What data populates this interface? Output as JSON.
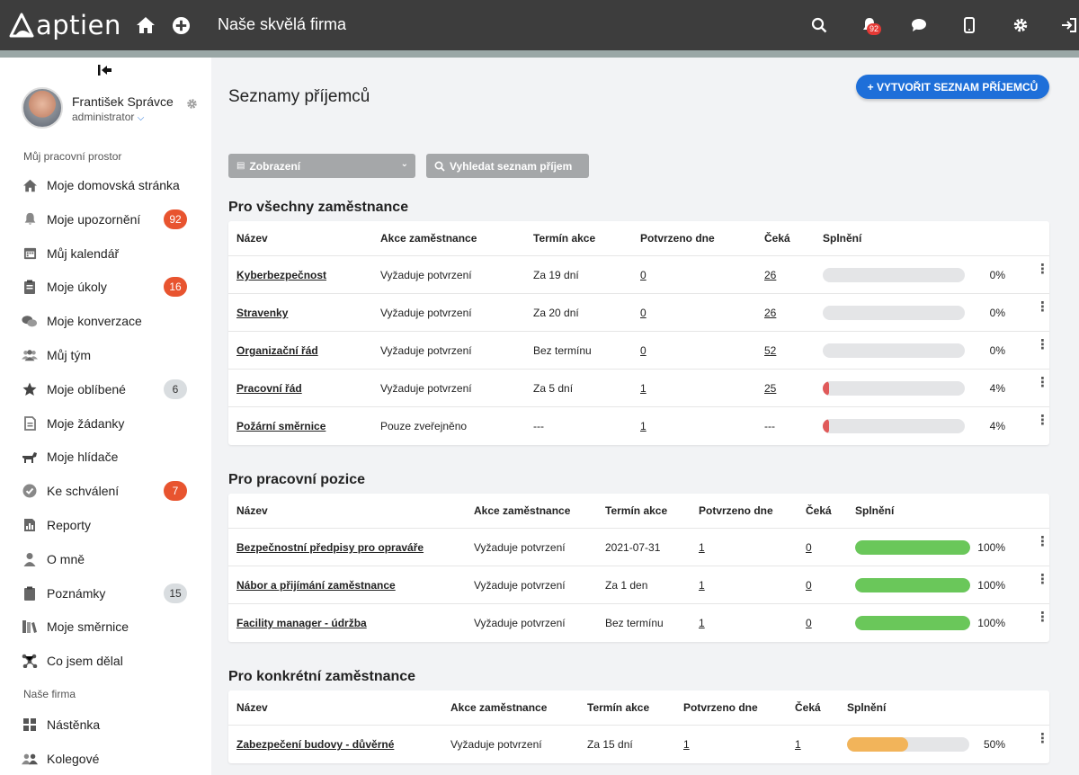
{
  "topbar": {
    "logo": "aptien",
    "company": "Naše skvělá firma",
    "notif_count": "92",
    "icons": [
      "home-icon",
      "plus-circle-icon",
      "search-icon",
      "bell-icon",
      "chat-icon",
      "mobile-icon",
      "gear-icon",
      "logout-icon"
    ]
  },
  "sidebar": {
    "user_name": "František Správce",
    "user_role": "administrator",
    "section1": "Můj pracovní prostor",
    "section2": "Naše firma",
    "items": [
      {
        "label": "Moje domovská stránka",
        "icon": "home-icon"
      },
      {
        "label": "Moje upozornění",
        "icon": "bell-icon",
        "badge": "92",
        "badge_color": "red"
      },
      {
        "label": "Můj kalendář",
        "icon": "calendar-icon"
      },
      {
        "label": "Moje úkoly",
        "icon": "clipboard-icon",
        "badge": "16",
        "badge_color": "red"
      },
      {
        "label": "Moje konverzace",
        "icon": "chat-icon"
      },
      {
        "label": "Můj tým",
        "icon": "team-icon"
      },
      {
        "label": "Moje oblíbené",
        "icon": "star-icon",
        "badge": "6",
        "badge_color": "grey"
      },
      {
        "label": "Moje žádanky",
        "icon": "document-icon"
      },
      {
        "label": "Moje hlídače",
        "icon": "dog-icon"
      },
      {
        "label": "Ke schválení",
        "icon": "check-circle-icon",
        "badge": "7",
        "badge_color": "red"
      },
      {
        "label": "Reporty",
        "icon": "report-icon"
      },
      {
        "label": "O mně",
        "icon": "user-icon"
      },
      {
        "label": "Poznámky",
        "icon": "notes-icon",
        "badge": "15",
        "badge_color": "grey"
      },
      {
        "label": "Moje směrnice",
        "icon": "books-icon"
      },
      {
        "label": "Co jsem dělal",
        "icon": "activity-icon"
      }
    ],
    "items2": [
      {
        "label": "Nástěnka",
        "icon": "board-icon"
      },
      {
        "label": "Kolegové",
        "icon": "colleagues-icon"
      }
    ]
  },
  "main": {
    "title": "Seznamy příjemců",
    "create_label": "+ VYTVOŘIT SEZNAM PŘÍJEMCŮ",
    "view_label": "Zobrazení",
    "search_label": "Vyhledat seznam příjem",
    "columns": [
      "Název",
      "Akce zaměstnance",
      "Termín akce",
      "Potvrzeno dne",
      "Čeká",
      "Splnění"
    ],
    "sections": [
      {
        "title": "Pro všechny zaměstnance",
        "rows": [
          {
            "name": "Kyberbezpečnost",
            "action": "Vyžaduje potvrzení",
            "term": "Za 19 dní",
            "confirmed": "0",
            "waiting": "26",
            "pct": "0%",
            "progress": 0
          },
          {
            "name": "Stravenky",
            "action": "Vyžaduje potvrzení",
            "term": "Za 20 dní",
            "confirmed": "0",
            "waiting": "26",
            "pct": "0%",
            "progress": 0
          },
          {
            "name": "Organizační řád",
            "action": "Vyžaduje potvrzení",
            "term": "Bez termínu",
            "confirmed": "0",
            "waiting": "52",
            "pct": "0%",
            "progress": 0
          },
          {
            "name": "Pracovní řád",
            "action": "Vyžaduje potvrzení",
            "term": "Za 5 dní",
            "confirmed": "1",
            "waiting": "25",
            "pct": "4%",
            "progress": 0.04
          },
          {
            "name": "Požární směrnice",
            "action": "Pouze zveřejněno",
            "term": "---",
            "confirmed": "1",
            "waiting": "---",
            "pct": "4%",
            "progress": 0.04
          }
        ]
      },
      {
        "title": "Pro pracovní pozice",
        "rows": [
          {
            "name": "Bezpečnostní předpisy pro opraváře",
            "action": "Vyžaduje potvrzení",
            "term": "2021-07-31",
            "confirmed": "1",
            "waiting": "0",
            "pct": "100%",
            "progress": 1
          },
          {
            "name": "Nábor a přijímání zaměstnance",
            "action": "Vyžaduje potvrzení",
            "term": "Za 1 den",
            "confirmed": "1",
            "waiting": "0",
            "pct": "100%",
            "progress": 1
          },
          {
            "name": "Facility manager - údržba",
            "action": "Vyžaduje potvrzení",
            "term": "Bez termínu",
            "confirmed": "1",
            "waiting": "0",
            "pct": "100%",
            "progress": 1
          }
        ]
      },
      {
        "title": "Pro konkrétní zaměstnance",
        "rows": [
          {
            "name": "Zabezpečení budovy - důvěrné",
            "action": "Vyžaduje potvrzení",
            "term": "Za 15 dní",
            "confirmed": "1",
            "waiting": "1",
            "pct": "50%",
            "progress": 0.5
          }
        ]
      }
    ]
  },
  "colors": {
    "accent": "#1e6fd9",
    "red": "#e05a5a",
    "green": "#6ac75a",
    "orange": "#f2b45a",
    "badge_red": "#e8542f"
  }
}
